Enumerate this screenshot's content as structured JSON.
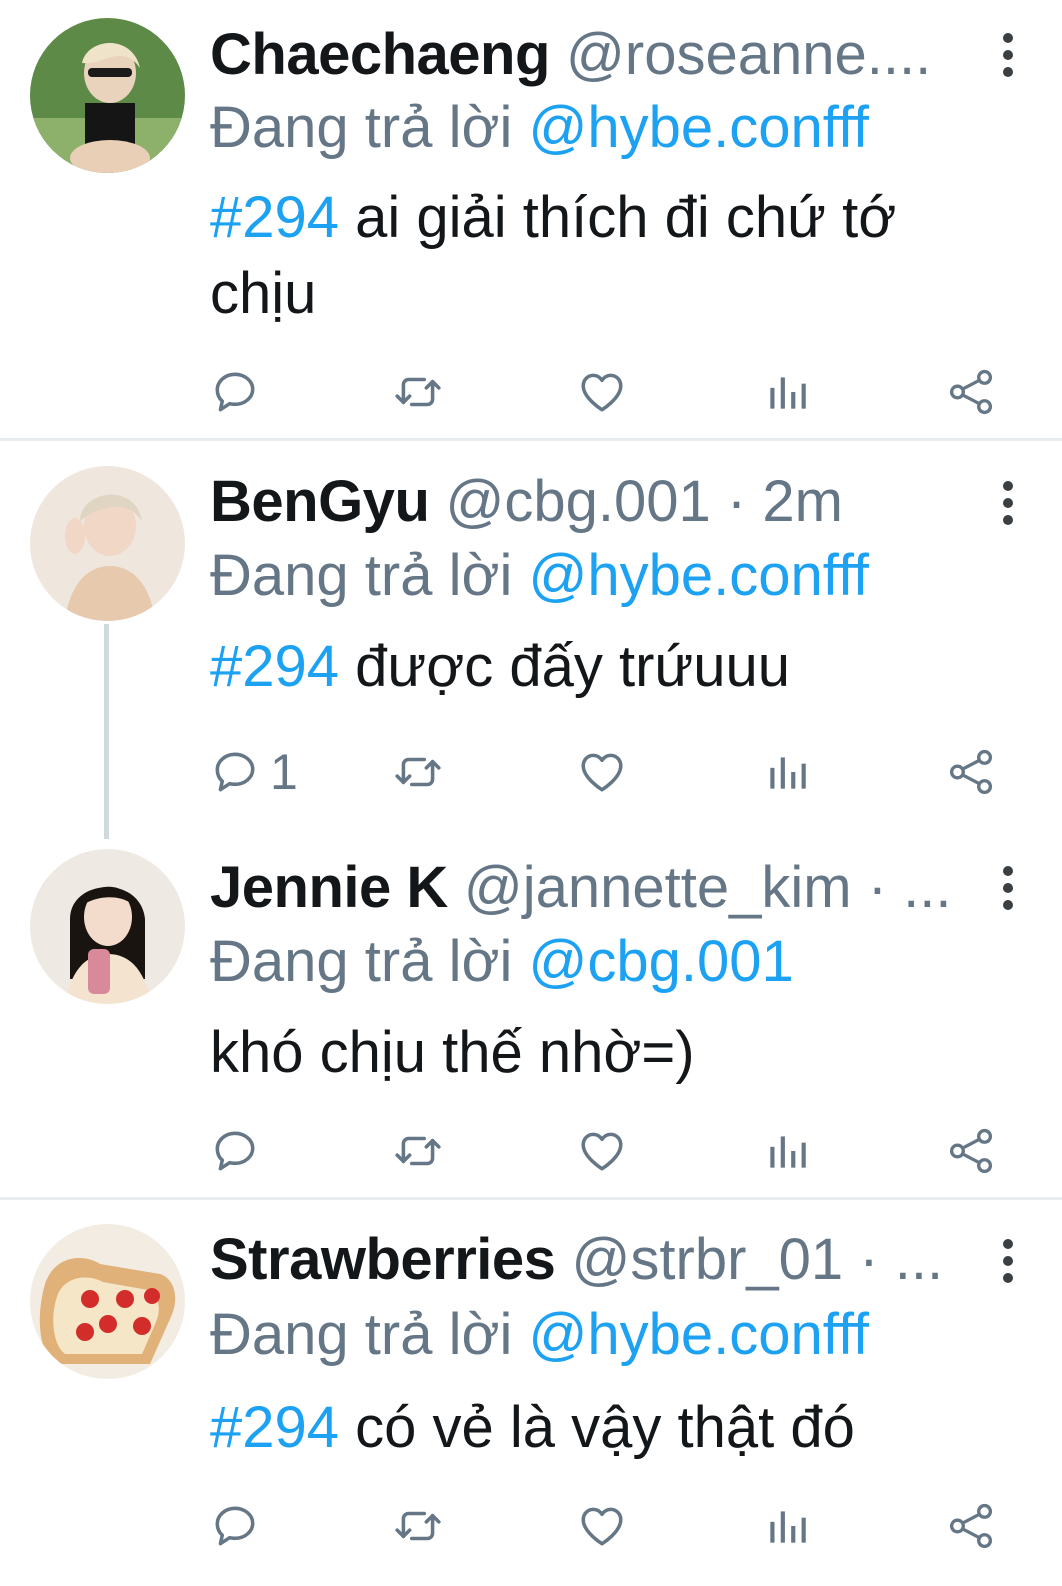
{
  "tweets": [
    {
      "name": "Chaechaeng",
      "handle": "@roseanne....",
      "reply_prefix": "Đang trả lời",
      "reply_to": "@hybe.confff",
      "hashtag": "#294",
      "text": " ai giải thích đi chứ tớ chịu",
      "reply_count": ""
    },
    {
      "name": "BenGyu",
      "handle": "@cbg.001 · 2m",
      "reply_prefix": "Đang trả lời",
      "reply_to": "@hybe.confff",
      "hashtag": "#294",
      "text": " được đấy trứuuu",
      "reply_count": "1"
    },
    {
      "name": "Jennie K",
      "handle": "@jannette_kim · ...",
      "reply_prefix": "Đang trả lời",
      "reply_to": "@cbg.001",
      "hashtag": "",
      "text": "khó chịu thế nhờ=)",
      "reply_count": ""
    },
    {
      "name": "Strawberries",
      "handle": "@strbr_01 · ...",
      "reply_prefix": "Đang trả lời",
      "reply_to": "@hybe.confff",
      "hashtag": "#294",
      "text": " có vẻ là vậy thật đó",
      "reply_count": ""
    }
  ],
  "icons": {
    "reply": "reply-bubble-icon",
    "retweet": "retweet-icon",
    "like": "heart-icon",
    "analytics": "bar-chart-icon",
    "share": "share-icon",
    "more": "vertical-dots-icon"
  },
  "colors": {
    "link": "#1da1f2",
    "secondary_text": "#657786",
    "primary_text": "#14171a",
    "divider": "#e6ecf0",
    "thread_line": "#cfd9de"
  }
}
